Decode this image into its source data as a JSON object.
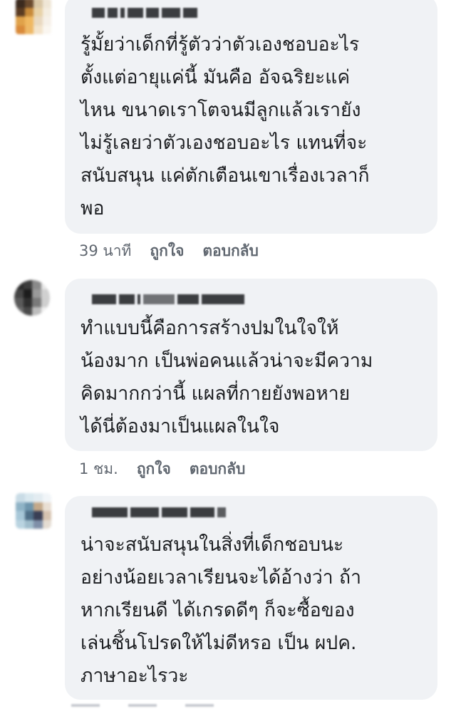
{
  "comments": [
    {
      "text": "รู้มั้ยว่าเด็กที่รู้ตัวว่าตัวเองชอบอะไร\nตั้งแต่อายุแค่นี้ มันคือ อัจฉริยะแค่\nไหน ขนาดเราโตจนมีลูกแล้วเรายัง\nไม่รู้เลยว่าตัวเองชอบอะไร แทนที่จะ\nสนับสนุน แค่ตักเตือนเขาเรื่องเวลาก็\nพอ",
      "time": "39 นาที",
      "like": "ถูกใจ",
      "reply": "ตอบกลับ"
    },
    {
      "text": "ทำแบบนี้คือการสร้างปมในใจให้\nน้องมาก เป็นพ่อคนแล้วน่าจะมีความ\nคิดมากกว่านี้ แผลที่กายยังพอหาย\nได้นี่ต้องมาเป็นแผลในใจ",
      "time": "1 ชม.",
      "like": "ถูกใจ",
      "reply": "ตอบกลับ"
    },
    {
      "text": "น่าจะสนับสนุนในสิ่งที่เด็กชอบนะ\nอย่างน้อยเวลาเรียนจะได้อ้างว่า ถ้า\nหากเรียนดี ได้เกรดดีๆ ก็จะซื้อของ\nเล่นชิ้นโปรดให้ไม่ดีหรอ เป็น ผปค.\nภาษาอะไรวะ"
    }
  ],
  "colors": {
    "bubble": "#f0f2f5",
    "text": "#1c1e21",
    "meta": "#606770"
  }
}
